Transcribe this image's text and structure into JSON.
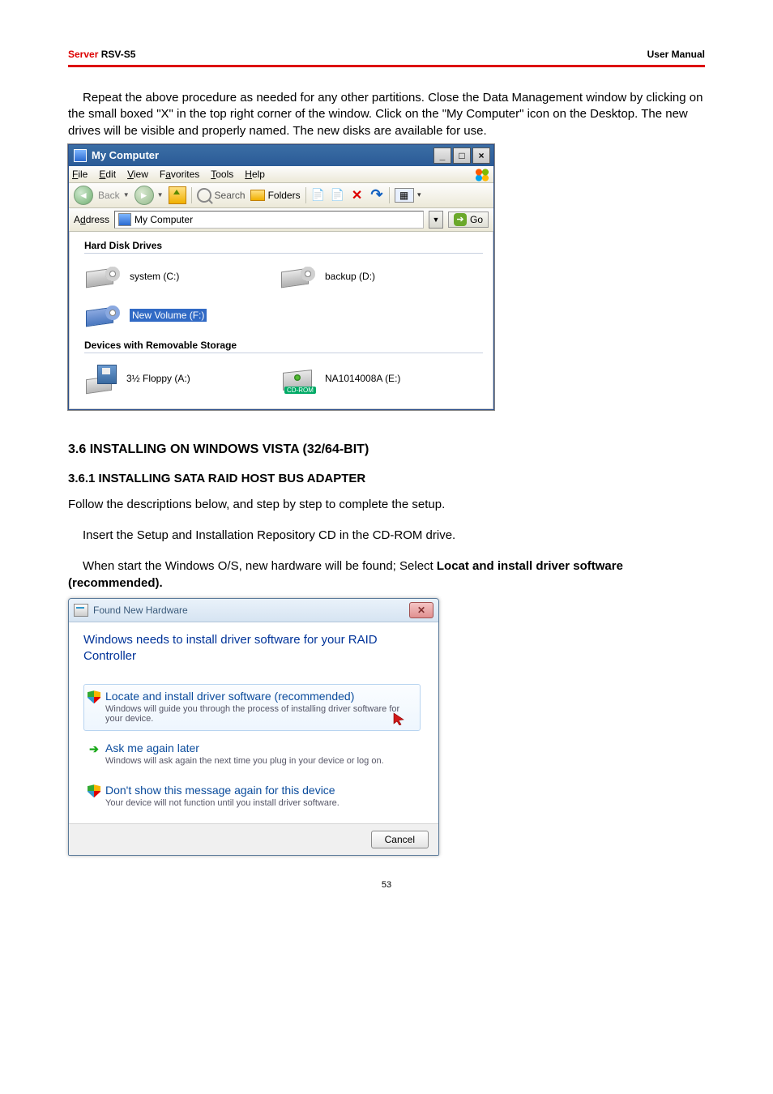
{
  "header": {
    "server_label": "Server",
    "model": " RSV-S5",
    "right": "User Manual"
  },
  "intro_para": "Repeat the above procedure as needed for any other partitions. Close the Data Management window by clicking on the small boxed \"X\" in the top right corner of the window. Click on the \"My Computer\" icon on the Desktop. The new drives will be visible and properly named. The new disks are available for use.",
  "xp": {
    "title": "My Computer",
    "menus": {
      "file": "File",
      "edit": "Edit",
      "view": "View",
      "favorites": "Favorites",
      "tools": "Tools",
      "help": "Help"
    },
    "toolbar": {
      "back": "Back",
      "search": "Search",
      "folders": "Folders"
    },
    "address_label": "Address",
    "address_value": "My Computer",
    "go": "Go",
    "group_hdd": "Hard Disk Drives",
    "group_removable": "Devices with Removable Storage",
    "drives": {
      "c": "system (C:)",
      "d": "backup (D:)",
      "f": "New Volume (F:)",
      "a": "3½ Floppy (A:)",
      "e": "NA1014008A (E:)",
      "cd_tag": "CD-ROM"
    }
  },
  "sections": {
    "s36": "3.6 INSTALLING ON WINDOWS VISTA (32/64-BIT)",
    "s361": "3.6.1 INSTALLING SATA RAID HOST BUS ADAPTER"
  },
  "paras": {
    "p1": "Follow the descriptions below, and step by step to complete the setup.",
    "p2": "Insert the Setup and Installation Repository CD in the CD-ROM drive.",
    "p3a": "When start the Windows O/S, new hardware will be found; Select ",
    "p3b": "Locat and install driver software (recommended)."
  },
  "vista": {
    "title": "Found New Hardware",
    "main": "Windows needs to install driver software for your RAID Controller",
    "opt1_t": "Locate and install driver software (recommended)",
    "opt1_s": "Windows will guide you through the process of installing driver software for your device.",
    "opt2_t": "Ask me again later",
    "opt2_s": "Windows will ask again the next time you plug in your device or log on.",
    "opt3_t": "Don't show this message again for this device",
    "opt3_s": "Your device will not function until you install driver software.",
    "cancel": "Cancel"
  },
  "page_number": "53"
}
